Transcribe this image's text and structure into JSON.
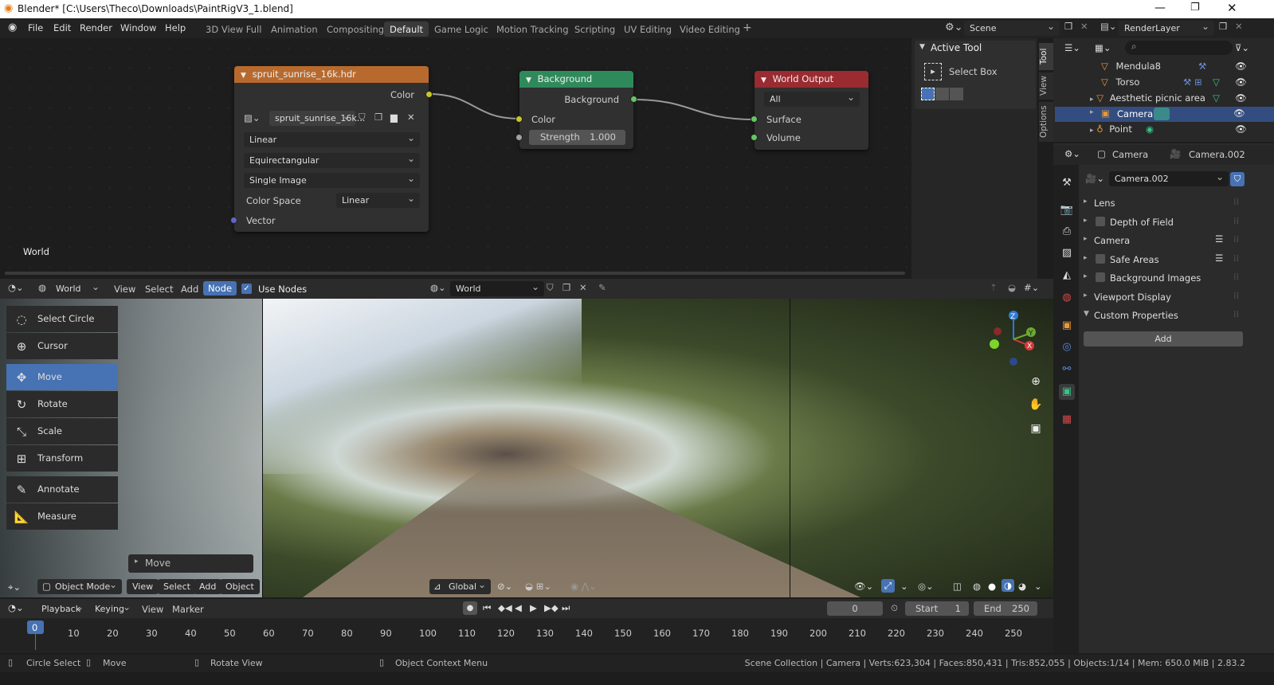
{
  "window": {
    "title": "Blender* [C:\\Users\\Theco\\Downloads\\PaintRigV3_1.blend]"
  },
  "menu": [
    "File",
    "Edit",
    "Render",
    "Window",
    "Help"
  ],
  "workspaces": [
    "3D View Full",
    "Animation",
    "Compositing",
    "Default",
    "Game Logic",
    "Motion Tracking",
    "Scripting",
    "UV Editing",
    "Video Editing"
  ],
  "scene": {
    "name": "Scene",
    "render_layer": "RenderLayer"
  },
  "nodes": {
    "image": {
      "title": "spruit_sunrise_16k.hdr",
      "out_color": "Color",
      "file": "spruit_sunrise_16k...",
      "interp": "Linear",
      "proj": "Equirectangular",
      "source": "Single Image",
      "cs_label": "Color Space",
      "cs_value": "Linear",
      "vector": "Vector"
    },
    "background": {
      "title": "Background",
      "out": "Background",
      "color": "Color",
      "strength_label": "Strength",
      "strength_value": "1.000"
    },
    "output": {
      "title": "World Output",
      "target": "All",
      "surface": "Surface",
      "volume": "Volume"
    }
  },
  "node_editor": {
    "context_label": "World",
    "world_select": "World",
    "menu_view": "View",
    "menu_select": "Select",
    "menu_add": "Add",
    "menu_node": "Node",
    "use_nodes": "Use Nodes",
    "world_name": "World"
  },
  "active_tool_panel": {
    "header": "Active Tool",
    "tool": "Select Box",
    "tabs": [
      "Tool",
      "View",
      "Options"
    ]
  },
  "outliner": [
    {
      "name": "Mendula8"
    },
    {
      "name": "Torso"
    },
    {
      "name": "Aesthetic picnic area"
    },
    {
      "name": "Camera"
    },
    {
      "name": "Point"
    }
  ],
  "properties": {
    "header_obj": "Camera",
    "header_data": "Camera.002",
    "data_name": "Camera.002",
    "panels": [
      "Lens",
      "Depth of Field",
      "Camera",
      "Safe Areas",
      "Background Images",
      "Viewport Display",
      "Custom Properties"
    ],
    "add_button": "Add"
  },
  "tools": [
    "Select Circle",
    "Cursor",
    "Move",
    "Rotate",
    "Scale",
    "Transform",
    "Annotate",
    "Measure"
  ],
  "last_op": "Move",
  "viewport_header": {
    "mode": "Object Mode",
    "view": "View",
    "select": "Select",
    "add": "Add",
    "object": "Object",
    "orientation": "Global"
  },
  "timeline": {
    "playback": "Playback",
    "keying": "Keying",
    "view": "View",
    "marker": "Marker",
    "current": "0",
    "start_label": "Start",
    "start": "1",
    "end_label": "End",
    "end": "250",
    "ticks": [
      "0",
      "10",
      "20",
      "30",
      "40",
      "50",
      "60",
      "70",
      "80",
      "90",
      "100",
      "110",
      "120",
      "130",
      "140",
      "150",
      "160",
      "170",
      "180",
      "190",
      "200",
      "210",
      "220",
      "230",
      "240",
      "250"
    ]
  },
  "statusbar": {
    "left1": "Circle Select",
    "left2": "Move",
    "left3": "Rotate View",
    "left4": "Object Context Menu",
    "right": "Scene Collection | Camera | Verts:623,304 | Faces:850,431 | Tris:852,055 | Objects:1/14 | Mem: 650.0 MiB | 2.83.2"
  },
  "colors": {
    "accent": "#4772b3",
    "image_node": "#b86a2e",
    "bg_node": "#2f8a5b",
    "output_node": "#9a2b31"
  }
}
